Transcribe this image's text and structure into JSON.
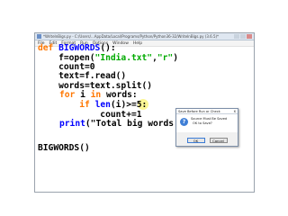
{
  "window": {
    "title": "*WriteInBigs.py - C:/Users/...AppData/Local/Programs/Python/Python36-32/WriteInBigs.py (3.6.5)*",
    "controls": [
      "minimize",
      "maximize",
      "close"
    ]
  },
  "menu": [
    "File",
    "Edit",
    "Format",
    "Run",
    "Options",
    "Window",
    "Help"
  ],
  "code": {
    "line1": {
      "kw": "def ",
      "name": "BIGWORDS",
      "rest": "():"
    },
    "line2": {
      "pre": "    f=open(",
      "s1": "\"India.txt\"",
      "mid": ",",
      "s2": "\"r\"",
      "post": ")"
    },
    "line3": "    count=0",
    "line4": "    text=f.read()",
    "line5": "    words=text.split()",
    "line6": {
      "kw1": "for",
      "mid": " i ",
      "kw2": "in",
      "post": " words:"
    },
    "line7": {
      "indent": "        ",
      "kw": "if",
      "mid": " ",
      "fn": "len",
      "post": "(i)>=5:"
    },
    "line8": "            count+=1",
    "line9": {
      "fn": "print",
      "str": "(\"Total big words >"
    },
    "line12": "BIGWORDS()"
  },
  "dialog": {
    "title": "Save Before Run or Check",
    "close": "x",
    "message_line1": "Source Must Be Saved",
    "message_line2": "OK to Save?",
    "icon_glyph": "?",
    "ok_label": "OK",
    "cancel_label": "Cancel"
  }
}
